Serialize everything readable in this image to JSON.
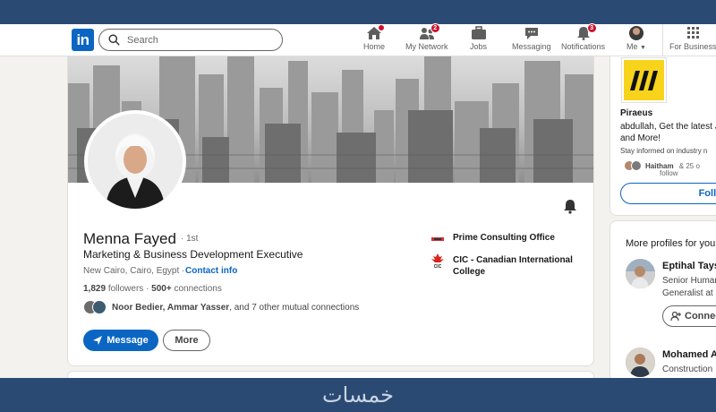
{
  "nav": {
    "logo": "in",
    "search_placeholder": "Search",
    "items": [
      {
        "label": "Home",
        "icon": "home-icon",
        "badge": ""
      },
      {
        "label": "My Network",
        "icon": "network-icon",
        "badge": "2"
      },
      {
        "label": "Jobs",
        "icon": "briefcase-icon",
        "badge": ""
      },
      {
        "label": "Messaging",
        "icon": "messaging-icon",
        "badge": ""
      },
      {
        "label": "Notifications",
        "icon": "bell-icon",
        "badge": "3"
      },
      {
        "label": "Me",
        "icon": "avatar",
        "badge": ""
      },
      {
        "label": "For Business",
        "icon": "grid-icon",
        "badge": ""
      }
    ]
  },
  "profile": {
    "name": "Menna Fayed",
    "degree": "· 1st",
    "headline": "Marketing & Business Development Executive",
    "location": "New Cairo, Cairo, Egypt ·",
    "contact_info": "Contact info",
    "followers": "1,829",
    "followers_label": "followers",
    "connections": "500+",
    "connections_label": "connections",
    "mutual_names": "Noor Bedier, Ammar Yasser",
    "mutual_rest": ", and 7 other mutual connections",
    "message_button": "Message",
    "more_button": "More",
    "orgs": [
      {
        "name": "Prime Consulting Office",
        "logo": "prime-logo"
      },
      {
        "name": "CIC - Canadian International College",
        "logo": "cic-logo"
      }
    ]
  },
  "ad": {
    "company": "Piraeus",
    "text": "abdullah, Get the latest Jobs, and More!",
    "small": "Stay informed on industry n",
    "people_name": "Haitham",
    "people_rest": "& 25 o",
    "people_sub": "follow",
    "follow_button": "Follow"
  },
  "more_profiles": {
    "title": "More profiles for you",
    "people": [
      {
        "name": "Eptihal Tays",
        "sub1": "Senior Human",
        "sub2": "Generalist at I",
        "button": "Connect"
      },
      {
        "name": "Mohamed A",
        "sub1": "Construction"
      }
    ]
  },
  "watermark": "خمسات",
  "colors": {
    "brand": "#0a66c2",
    "badge": "#cb112d",
    "frame": "#2b4a73",
    "ad_logo": "#f7d31b"
  }
}
